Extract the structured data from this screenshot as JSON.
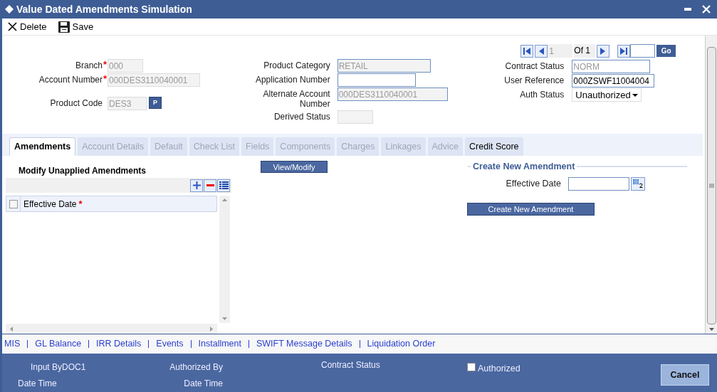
{
  "window": {
    "title": "Value Dated Amendments Simulation"
  },
  "toolbar": [
    {
      "label": "Delete",
      "kind": "delete"
    },
    {
      "label": "Save",
      "kind": "save"
    }
  ],
  "header": {
    "left": [
      {
        "label": "Branch",
        "required_mark": "*",
        "value": "000",
        "disabled": true,
        "kind": "text"
      },
      {
        "label": "Account Number",
        "required_mark": "*",
        "value": "000DES3110040001",
        "disabled": true,
        "kind": "text"
      },
      {
        "label": "Product Code",
        "value": "DES3",
        "disabled": true,
        "kind": "lookup",
        "button": "P"
      }
    ],
    "middle": [
      {
        "label": "Product Category",
        "value": "RETAIL",
        "disabled": true,
        "kind": "text"
      },
      {
        "label": "Application Number",
        "disabled": false,
        "kind": "text"
      },
      {
        "label": "Alternate Account Number",
        "value": "000DES3110040001",
        "disabled": true,
        "kind": "text"
      },
      {
        "label": "Derived Status",
        "disabled": true,
        "kind": "text"
      }
    ],
    "pager": {
      "current": "1",
      "of": "Of 1",
      "go": "Go"
    },
    "right": [
      {
        "label": "Contract Status",
        "value": "NORM",
        "disabled": true,
        "kind": "text"
      },
      {
        "label": "User Reference",
        "value": "000ZSWF11004004",
        "disabled": false,
        "kind": "text"
      },
      {
        "label": "Auth Status",
        "value": "Unauthorized",
        "kind": "select"
      }
    ]
  },
  "tabs": [
    {
      "label": "Amendments",
      "selected": true,
      "disabled": false
    },
    {
      "label": "Account Details",
      "selected": false,
      "disabled": true
    },
    {
      "label": "Default",
      "selected": false,
      "disabled": true
    },
    {
      "label": "Check List",
      "selected": false,
      "disabled": true
    },
    {
      "label": "Fields",
      "selected": false,
      "disabled": true
    },
    {
      "label": "Components",
      "selected": false,
      "disabled": true
    },
    {
      "label": "Charges",
      "selected": false,
      "disabled": true
    },
    {
      "label": "Linkages",
      "selected": false,
      "disabled": true
    },
    {
      "label": "Advice",
      "selected": false,
      "disabled": true
    },
    {
      "label": "Credit Score",
      "selected": false,
      "disabled": false
    }
  ],
  "unapplied": {
    "title": "Modify Unapplied Amendments",
    "columns": [
      {
        "label": "Effective Date",
        "required_mark": "*"
      }
    ],
    "select_all": {
      "checked": false
    }
  },
  "view_modify_button": "View/Modify",
  "create_new": {
    "legend": "Create New Amendment",
    "field": {
      "label": "Effective Date"
    },
    "button": "Create New Amendment"
  },
  "links": [
    "MIS",
    "GL Balance",
    "IRR Details",
    "Events",
    "Installment",
    "SWIFT Message Details",
    "Liquidation Order"
  ],
  "footer": {
    "input_by": "Input ByDOC1",
    "date_time_1": "Date Time",
    "authorized_by": "Authorized By",
    "date_time_2": "Date Time",
    "contract_status": "Contract Status",
    "authorized": {
      "label": "Authorized",
      "checked": false
    },
    "cancel": "Cancel"
  }
}
